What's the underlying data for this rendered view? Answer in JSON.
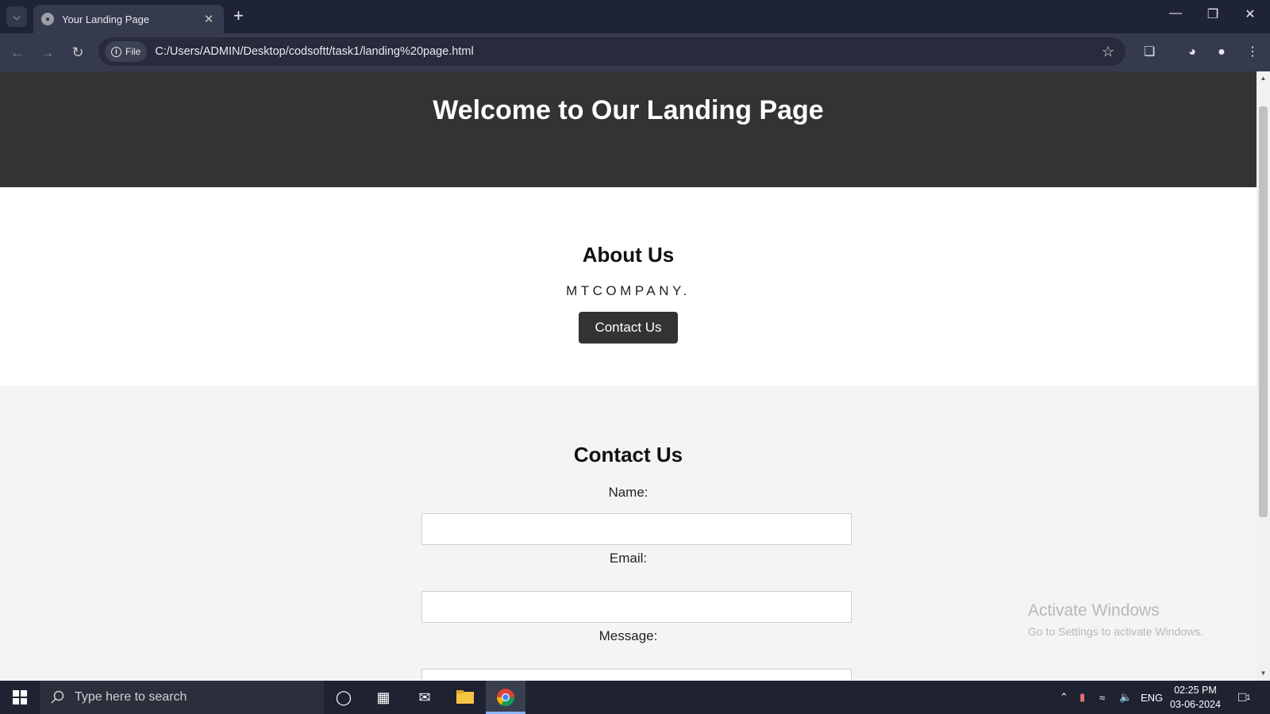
{
  "browser": {
    "tab_title": "Your Landing Page",
    "address_chip": "File",
    "url": "C:/Users/ADMIN/Desktop/codsoftt/task1/landing%20page.html"
  },
  "page": {
    "hero_title": "Welcome to Our Landing Page",
    "about": {
      "heading": "About Us",
      "text": "MTCOMPANY.",
      "cta_label": "Contact Us"
    },
    "contact": {
      "heading": "Contact Us",
      "name_label": "Name:",
      "email_label": "Email:",
      "message_label": "Message:"
    }
  },
  "watermark": {
    "line1": "Activate Windows",
    "line2": "Go to Settings to activate Windows."
  },
  "taskbar": {
    "search_placeholder": "Type here to search",
    "language": "ENG",
    "time": "02:25 PM",
    "date": "03-06-2024",
    "notification_count": "1"
  }
}
